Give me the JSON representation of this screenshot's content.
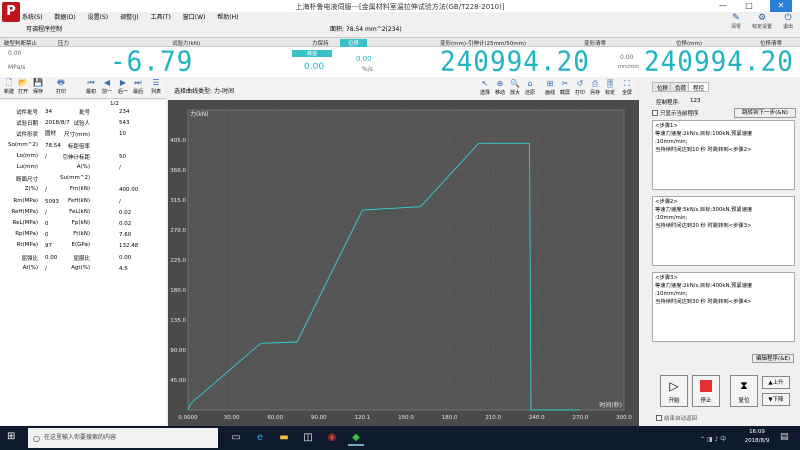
{
  "window": {
    "title": "上海朴鲁电液伺服---[金属材料室温拉伸试验方法(GB/T228-2010)]",
    "logo": "P",
    "min": "—",
    "max": "□",
    "close": "✕"
  },
  "menu": [
    "系统(S)",
    "数据(D)",
    "设置(S)",
    "调整(J)",
    "工具(T)",
    "窗口(W)",
    "帮助(H)"
  ],
  "subtitle": "可调程序控制",
  "formula": "面积: 78.54 mm^2(234)",
  "right_tools": [
    {
      "icon": "✎",
      "label": "清零"
    },
    {
      "icon": "⚙",
      "label": "标定设置"
    },
    {
      "icon": "⏻",
      "label": "退出"
    }
  ],
  "labels": {
    "break": "破型判断禁止",
    "pressure": "压力",
    "force": "试验力(kN)",
    "force_unit": "力保持",
    "position": "位移",
    "deform": "变形(mm)-引伸计(25mm/50mm)",
    "deform_clear": "变形清零",
    "displacement": "位移(mm)",
    "disp_clear": "位移清零"
  },
  "display": {
    "rate_unit": "MPa/s",
    "rate": "0.00",
    "force_value": "-6.79",
    "stage": "0.00",
    "stage_label": "峰值",
    "pressure": "0.00",
    "pressure_unit": "%/s",
    "deform_value": "240994.20",
    "deform_unit": "mm/min",
    "disp_rate": "0.00",
    "disp_value": "240994.20"
  },
  "toolbar": [
    {
      "icon": "🗋",
      "label": "新建"
    },
    {
      "icon": "📂",
      "label": "打开"
    },
    {
      "icon": "💾",
      "label": "保存"
    },
    {
      "icon": "🖶",
      "label": "打印"
    },
    {
      "icon": "⏮",
      "label": "最初"
    },
    {
      "icon": "◀",
      "label": "前一"
    },
    {
      "icon": "▶",
      "label": "后一"
    },
    {
      "icon": "⏭",
      "label": "最后"
    },
    {
      "icon": "☰",
      "label": "列表"
    }
  ],
  "page_indicator": "1/2",
  "fields": [
    {
      "l": "试件批号",
      "v": "34",
      "l2": "批号",
      "v2": "234"
    },
    {
      "l": "试验日期",
      "v": "2018/8/7",
      "l2": "试验人",
      "v2": "543"
    },
    {
      "l": "试件形状",
      "v": "圆材",
      "l2": "尺寸(mm)",
      "v2": "10"
    },
    {
      "l": "So(mm^2)",
      "v": "78.54",
      "l2": "标距倍率",
      "v2": ""
    },
    {
      "l": "Lo(mm)",
      "v": "/",
      "l2": "引伸计标距",
      "v2": "50"
    },
    {
      "l": "Lu(mm)",
      "v": "",
      "l2": "A(%)",
      "v2": "/"
    },
    {
      "l": "断面尺寸",
      "v": "",
      "l2": "Su(mm^2)",
      "v2": ""
    },
    {
      "l": "Z(%)",
      "v": "/",
      "l2": "Fm(kN)",
      "v2": "400.00"
    },
    {
      "l": "Rm(MPa)",
      "v": "5093",
      "l2": "FeH(kN)",
      "v2": "/"
    },
    {
      "l": "ReH(MPa)",
      "v": "/",
      "l2": "FeL(kN)",
      "v2": "0.02"
    },
    {
      "l": "ReL(MPa)",
      "v": "0",
      "l2": "Fp(kN)",
      "v2": "0.02"
    },
    {
      "l": "Rp(MPa)",
      "v": "0",
      "l2": "Ft(kN)",
      "v2": "7.60"
    },
    {
      "l": "Rt(MPa)",
      "v": "97",
      "l2": "E(GPa)",
      "v2": "132.48"
    },
    {
      "l": "屈强比",
      "v": "0.00",
      "l2": "屈服比",
      "v2": "0.00"
    },
    {
      "l": "At(%)",
      "v": "/",
      "l2": "Agt(%)",
      "v2": "4.5"
    }
  ],
  "curve_type_label": "选择曲线类型:",
  "curve_type": "力-时间",
  "chart_tools": [
    {
      "icon": "↖",
      "label": "选择"
    },
    {
      "icon": "⊕",
      "label": "移动"
    },
    {
      "icon": "🔍",
      "label": "放大"
    },
    {
      "icon": "⌂",
      "label": "还原"
    },
    {
      "icon": "⊞",
      "label": "画线"
    },
    {
      "icon": "✂",
      "label": "截屏"
    },
    {
      "icon": "↺",
      "label": "打印"
    },
    {
      "icon": "⎙",
      "label": "另存"
    },
    {
      "icon": "🎚",
      "label": "标定"
    },
    {
      "icon": "⛶",
      "label": "全屏"
    }
  ],
  "chart_data": {
    "type": "line",
    "ylabel": "力(kN)",
    "xlabel": "时间(秒)",
    "xlim": [
      0,
      300
    ],
    "ylim": [
      0,
      450
    ],
    "xticks": [
      0,
      30,
      60,
      90,
      120,
      150,
      180,
      210,
      240,
      270,
      300
    ],
    "xtick_labels": [
      "0.0000",
      "30.00",
      "60.00",
      "90.00",
      "120.1",
      "150.0",
      "180.0",
      "210.0",
      "240.0",
      "270.0",
      "300.0"
    ],
    "yticks": [
      45,
      90,
      135,
      180,
      225,
      270,
      315,
      360,
      405
    ],
    "ytick_labels": [
      "45.00",
      "90.00",
      "135.0",
      "180.0",
      "225.0",
      "270.0",
      "315.0",
      "360.0",
      "405.0"
    ],
    "color": "#2ed1d8",
    "x": [
      0,
      2,
      50,
      75,
      120,
      160,
      200,
      235,
      236,
      255,
      270
    ],
    "y": [
      0,
      10,
      100,
      102,
      300,
      305,
      400,
      400,
      0,
      0,
      0
    ]
  },
  "right": {
    "tabs": [
      "位移",
      "负荷",
      "程控"
    ],
    "active": 2,
    "program_label": "控制程序:",
    "program_value": "123",
    "only_current": "只显示当前程序",
    "jump": "跳转到下一步(&N)",
    "edit": "编辑程序(&E)",
    "result": "结束自动返回"
  },
  "steps": [
    {
      "name": "<步骤1>",
      "l1": "等速力速度:2kN/s,目标:100kN,预紧速度",
      "l2": ":10mm/min;",
      "l3": "当持续时间达到10 秒 时跳转到<步骤2>"
    },
    {
      "name": "<步骤2>",
      "l1": "等速力速度:5kN/s,目标:300kN,预紧速度",
      "l2": ":10mm/min;",
      "l3": "当持续时间达到30 秒 时跳转到<步骤3>"
    },
    {
      "name": "<步骤3>",
      "l1": "等速力速度:2kN/s,目标:400kN,预紧速度",
      "l2": ":10mm/min;",
      "l3": "当持续时间达到30 秒 时跳转到<步骤4>"
    }
  ],
  "control": {
    "start": "开始",
    "stop": "停止",
    "reset": "复位",
    "up": "上升",
    "down": "下降"
  },
  "taskbar": {
    "search": "在这里输入你要搜索的内容",
    "time": "16:09",
    "date": "2018/8/9"
  }
}
